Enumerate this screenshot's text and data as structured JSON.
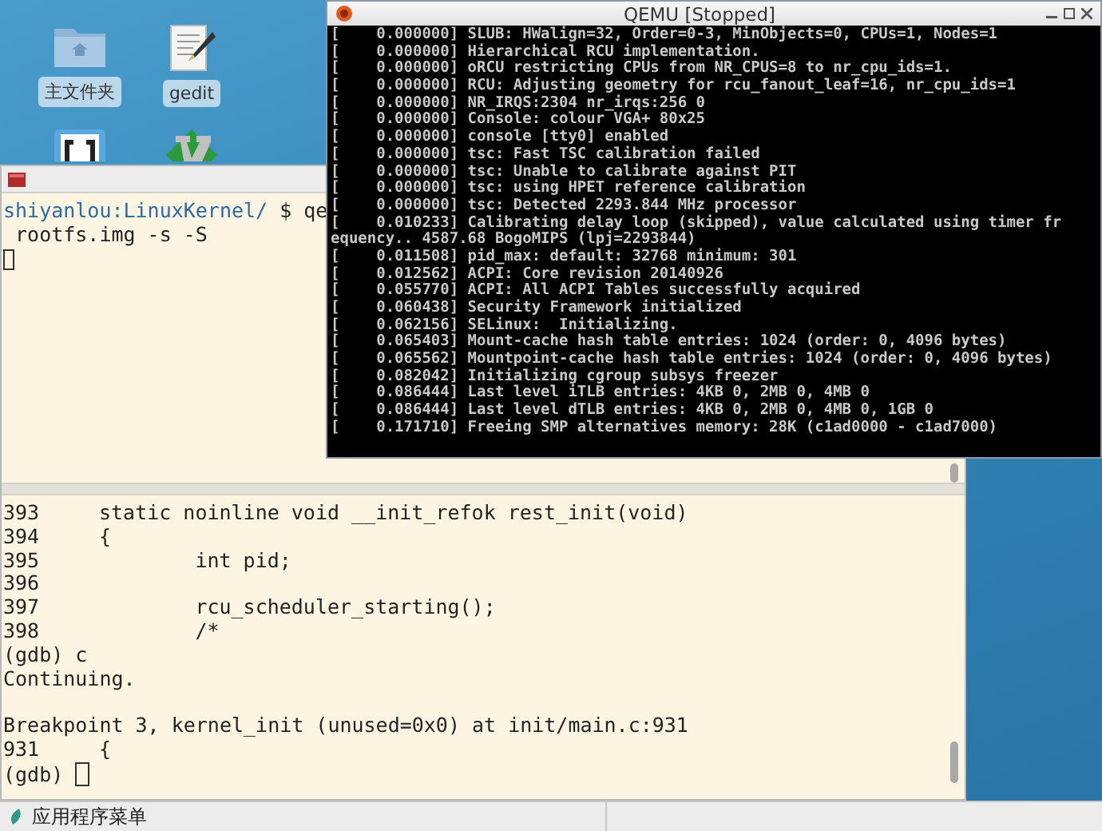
{
  "desktop_icons": [
    {
      "kind": "folder",
      "label": "主文件夹"
    },
    {
      "kind": "editor",
      "label": "gedit"
    },
    {
      "kind": "brackets"
    },
    {
      "kind": "vim"
    }
  ],
  "terminal": {
    "prompt": "shiyanlou:LinuxKernel/",
    "command": " $ qe",
    "shell_lines": [
      " rootfs.img -s -S"
    ],
    "gdb_lines": [
      {
        "kind": "source",
        "number": "393",
        "code": "static noinline void __init_refok rest_init(void)"
      },
      {
        "kind": "source",
        "number": "394",
        "code": "{"
      },
      {
        "kind": "source",
        "number": "395",
        "code": "        int pid;"
      },
      {
        "kind": "source",
        "number": "396"
      },
      {
        "kind": "source",
        "number": "397",
        "code": "        rcu_scheduler_starting();"
      },
      {
        "kind": "source",
        "number": "398",
        "code": "        /*"
      },
      {
        "kind": "text",
        "text": "(gdb) c"
      },
      {
        "kind": "text",
        "text": "Continuing."
      },
      {
        "kind": "blank"
      },
      {
        "kind": "text",
        "text": "Breakpoint 3, kernel_init (unused=0x0) at init/main.c:931"
      },
      {
        "kind": "source",
        "number": "931",
        "code": "{"
      },
      {
        "kind": "prompt",
        "text": "(gdb)"
      }
    ]
  },
  "qemu_window": {
    "title": "QEMU [Stopped]",
    "console_lines": [
      "[    0.000000] SLUB: HWalign=32, Order=0-3, MinObjects=0, CPUs=1, Nodes=1",
      "[    0.000000] Hierarchical RCU implementation.",
      "[    0.000000] oRCU restricting CPUs from NR_CPUS=8 to nr_cpu_ids=1.",
      "[    0.000000] RCU: Adjusting geometry for rcu_fanout_leaf=16, nr_cpu_ids=1",
      "[    0.000000] NR_IRQS:2304 nr_irqs:256 0",
      "[    0.000000] Console: colour VGA+ 80x25",
      "[    0.000000] console [tty0] enabled",
      "[    0.000000] tsc: Fast TSC calibration failed",
      "[    0.000000] tsc: Unable to calibrate against PIT",
      "[    0.000000] tsc: using HPET reference calibration",
      "[    0.000000] tsc: Detected 2293.844 MHz processor",
      "[    0.010233] Calibrating delay loop (skipped), value calculated using timer fr",
      "equency.. 4587.68 BogoMIPS (lpj=2293844)",
      "[    0.011508] pid_max: default: 32768 minimum: 301",
      "[    0.012562] ACPI: Core revision 20140926",
      "[    0.055770] ACPI: All ACPI Tables successfully acquired",
      "[    0.060438] Security Framework initialized",
      "[    0.062156] SELinux:  Initializing.",
      "[    0.065403] Mount-cache hash table entries: 1024 (order: 0, 4096 bytes)",
      "[    0.065562] Mountpoint-cache hash table entries: 1024 (order: 0, 4096 bytes)",
      "[    0.082042] Initializing cgroup subsys freezer",
      "[    0.086444] Last level iTLB entries: 4KB 0, 2MB 0, 4MB 0",
      "[    0.086444] Last level dTLB entries: 4KB 0, 2MB 0, 4MB 0, 1GB 0",
      "[    0.171710] Freeing SMP alternatives memory: 28K (c1ad0000 - c1ad7000)"
    ]
  },
  "taskbar": {
    "menu_label": "应用程序菜单"
  }
}
